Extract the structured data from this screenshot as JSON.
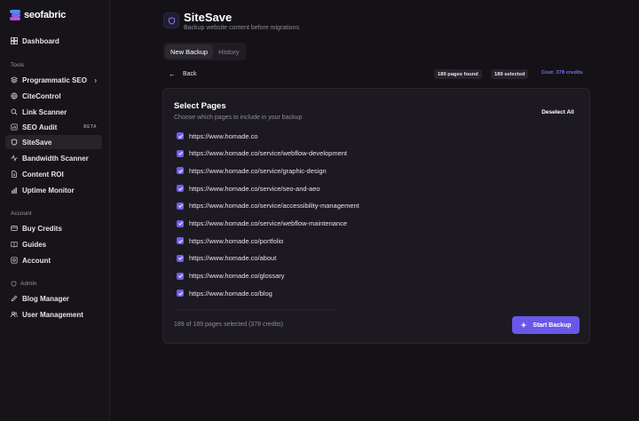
{
  "brand": {
    "name": "seofabric",
    "logo_colors": [
      "#4f8cf7",
      "#7a63f2",
      "#c14fd6"
    ]
  },
  "sidebar": {
    "dashboard": {
      "label": "Dashboard",
      "icon": "dashboard-icon"
    },
    "tools_label": "Tools",
    "tools": [
      {
        "label": "Programmatic SEO",
        "icon": "layers-icon",
        "has_chevron": true
      },
      {
        "label": "CiteControl",
        "icon": "globe-icon"
      },
      {
        "label": "Link Scanner",
        "icon": "search-icon"
      },
      {
        "label": "SEO Audit",
        "icon": "chart-icon",
        "badge": "BETA"
      },
      {
        "label": "SiteSave",
        "icon": "shield-icon",
        "active": true
      },
      {
        "label": "Bandwidth Scanner",
        "icon": "activity-icon"
      },
      {
        "label": "Content ROI",
        "icon": "document-icon"
      },
      {
        "label": "Uptime Monitor",
        "icon": "bar-chart-icon"
      }
    ],
    "account_label": "Account",
    "account": [
      {
        "label": "Buy Credits",
        "icon": "credit-card-icon"
      },
      {
        "label": "Guides",
        "icon": "book-icon"
      },
      {
        "label": "Account",
        "icon": "settings-icon"
      }
    ],
    "admin_label": "Admin",
    "admin": [
      {
        "label": "Blog Manager",
        "icon": "edit-icon"
      },
      {
        "label": "User Management",
        "icon": "users-icon"
      }
    ]
  },
  "header": {
    "title": "SiteSave",
    "subtitle": "Backup website content before migrations",
    "icon": "shield-icon"
  },
  "tabs": [
    {
      "label": "New Backup",
      "active": true
    },
    {
      "label": "History",
      "active": false
    }
  ],
  "toolbar": {
    "back_label": "Back",
    "pages_found": "189 pages found",
    "selected": "189 selected",
    "cost": "Cost: 378 credits"
  },
  "card": {
    "title": "Select Pages",
    "subtitle": "Choose which pages to include in your backup",
    "deselect_label": "Deselect All",
    "pages": [
      {
        "url": "https://www.homade.co",
        "checked": true
      },
      {
        "url": "https://www.homade.co/service/webflow-development",
        "checked": true
      },
      {
        "url": "https://www.homade.co/service/graphic-design",
        "checked": true
      },
      {
        "url": "https://www.homade.co/service/seo-and-aeo",
        "checked": true
      },
      {
        "url": "https://www.homade.co/service/accessibility-management",
        "checked": true
      },
      {
        "url": "https://www.homade.co/service/webflow-maintenance",
        "checked": true
      },
      {
        "url": "https://www.homade.co/portfolio",
        "checked": true
      },
      {
        "url": "https://www.homade.co/about",
        "checked": true
      },
      {
        "url": "https://www.homade.co/glossary",
        "checked": true
      },
      {
        "url": "https://www.homade.co/blog",
        "checked": true
      }
    ],
    "footer_text": "189 of 189 pages selected (378 credits)",
    "start_label": "Start Backup"
  },
  "colors": {
    "accent": "#6a57e8",
    "cost_text": "#7f6cf5",
    "background": "#141217",
    "card": "#1c1a20"
  }
}
